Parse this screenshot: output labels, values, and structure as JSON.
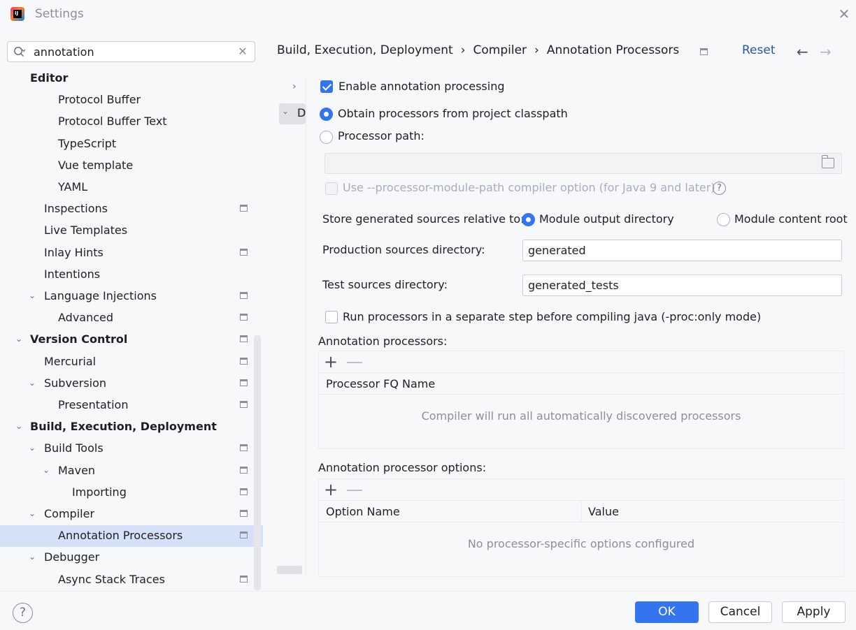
{
  "window": {
    "title": "Settings",
    "close_icon": "close-icon"
  },
  "search": {
    "value": "annotation"
  },
  "sidebar": {
    "items": [
      {
        "label": "Editor",
        "level": 1,
        "bold": true,
        "expander": ""
      },
      {
        "label": "Protocol Buffer",
        "level": 3
      },
      {
        "label": "Protocol Buffer Text",
        "level": 3
      },
      {
        "label": "TypeScript",
        "level": 3
      },
      {
        "label": "Vue template",
        "level": 3
      },
      {
        "label": "YAML",
        "level": 3
      },
      {
        "label": "Inspections",
        "level": 2,
        "project_icon": true
      },
      {
        "label": "Live Templates",
        "level": 2
      },
      {
        "label": "Inlay Hints",
        "level": 2,
        "project_icon": true
      },
      {
        "label": "Intentions",
        "level": 2
      },
      {
        "label": "Language Injections",
        "level": 2,
        "expander": "down",
        "project_icon": true
      },
      {
        "label": "Advanced",
        "level": 3,
        "project_icon": true
      },
      {
        "label": "Version Control",
        "level": 1,
        "bold": true,
        "expander": "down",
        "project_icon": true
      },
      {
        "label": "Mercurial",
        "level": 2,
        "project_icon": true
      },
      {
        "label": "Subversion",
        "level": 2,
        "expander": "down",
        "project_icon": true
      },
      {
        "label": "Presentation",
        "level": 3,
        "project_icon": true
      },
      {
        "label": "Build, Execution, Deployment",
        "level": 1,
        "bold": true,
        "expander": "down"
      },
      {
        "label": "Build Tools",
        "level": 2,
        "expander": "down",
        "project_icon": true
      },
      {
        "label": "Maven",
        "level": 3,
        "expander": "down",
        "project_icon": true
      },
      {
        "label": "Importing",
        "level": 4,
        "project_icon": true
      },
      {
        "label": "Compiler",
        "level": 2,
        "expander": "down",
        "project_icon": true
      },
      {
        "label": "Annotation Processors",
        "level": 3,
        "selected": true,
        "project_icon": true
      },
      {
        "label": "Debugger",
        "level": 2,
        "expander": "down"
      },
      {
        "label": "Async Stack Traces",
        "level": 3,
        "project_icon": true
      }
    ]
  },
  "breadcrumb": {
    "items": [
      "Build, Execution, Deployment",
      "Compiler",
      "Annotation Processors"
    ],
    "separator": "›",
    "reset_label": "Reset"
  },
  "mini_tree": {
    "row2_label": "D"
  },
  "content": {
    "enable_processing": {
      "label": "Enable annotation processing",
      "checked": true
    },
    "obtain_classpath": {
      "label": "Obtain processors from project classpath",
      "selected": true
    },
    "processor_path": {
      "label": "Processor path:",
      "selected": false,
      "value": ""
    },
    "module_path_option": {
      "label": "Use --processor-module-path compiler option (for Java 9 and later)",
      "checked": false,
      "disabled": true
    },
    "store_relative": {
      "label": "Store generated sources relative to:",
      "options": [
        "Module output directory",
        "Module content root"
      ],
      "selected": "Module output directory"
    },
    "production_dir": {
      "label": "Production sources directory:",
      "value": "generated"
    },
    "test_dir": {
      "label": "Test sources directory:",
      "value": "generated_tests"
    },
    "proc_only": {
      "label": "Run processors in a separate step before compiling java (-proc:only mode)",
      "checked": false
    },
    "processors_table": {
      "title": "Annotation processors:",
      "add": "+",
      "remove": "—",
      "columns": [
        "Processor FQ Name"
      ],
      "empty_text": "Compiler will run all automatically discovered processors"
    },
    "options_table": {
      "title": "Annotation processor options:",
      "add": "+",
      "remove": "—",
      "columns": [
        "Option Name",
        "Value"
      ],
      "empty_text": "No processor-specific options configured"
    }
  },
  "footer": {
    "help": "?",
    "ok": "OK",
    "cancel": "Cancel",
    "apply": "Apply"
  },
  "colors": {
    "accent": "#3574f0",
    "link": "#2e55a3",
    "selection": "#d5e1f8",
    "background": "#f7f8fa"
  }
}
